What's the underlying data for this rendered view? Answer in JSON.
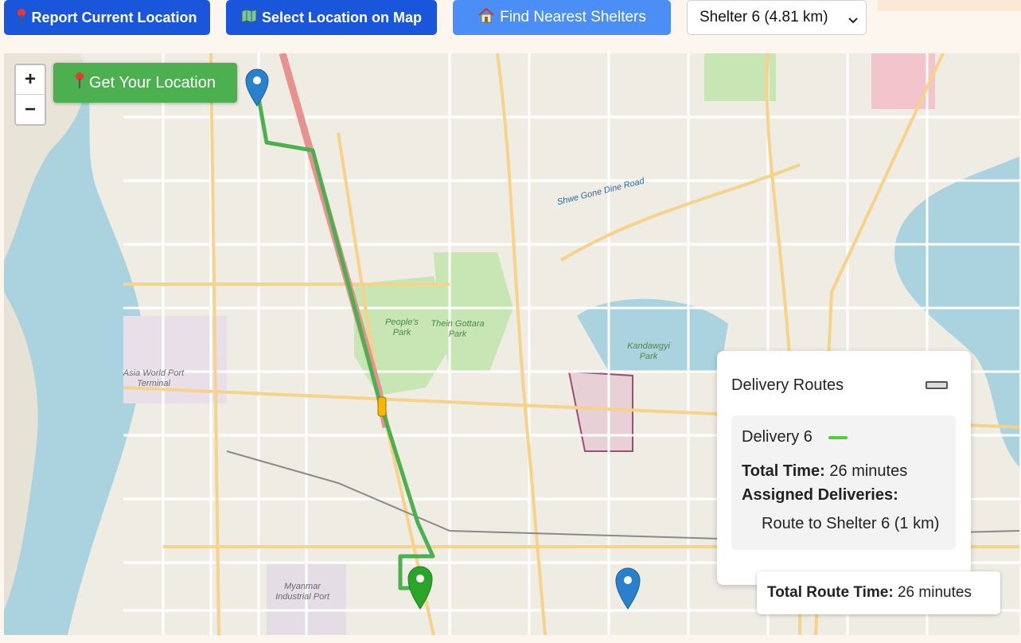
{
  "toolbar": {
    "report_label": "Report Current Location",
    "select_label": "Select Location on Map",
    "find_label": "Find Nearest Shelters",
    "shelter_select_value": "Shelter 6 (4.81 km)"
  },
  "map": {
    "zoom_in": "+",
    "zoom_out": "−",
    "get_location_label": "Get Your Location",
    "labels": {
      "peoples_park": "People's Park",
      "thein_gottara": "Thein Gottara Park",
      "kandawgyi": "Kandawgyi Park",
      "asia_world": "Asia World Port Terminal",
      "myanmar_industrial": "Myanmar Industrial Port",
      "shwe_gone_dine": "Shwe Gone Dine Road"
    }
  },
  "panel": {
    "title": "Delivery Routes",
    "delivery_name": "Delivery 6",
    "total_time_label": "Total Time:",
    "total_time_value": "26 minutes",
    "assigned_label": "Assigned Deliveries:",
    "route_item": "Route to Shelter 6 (1 km)"
  },
  "footer": {
    "total_route_label": "Total Route Time:",
    "total_route_value": "26 minutes"
  },
  "colors": {
    "primary_button": "#1a56db",
    "find_button": "#4b8ef5",
    "get_location_button": "#4caf50",
    "route_line": "#4caf50",
    "delivery_swatch": "#4cd137"
  }
}
